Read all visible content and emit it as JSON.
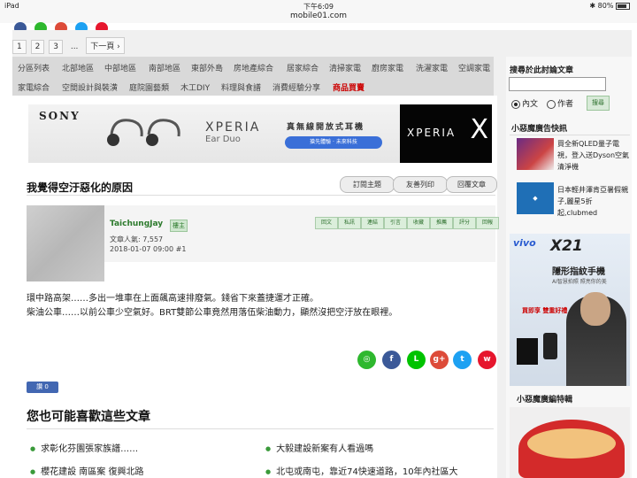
{
  "statusbar": {
    "device": "iPad",
    "time": "下午6:09",
    "url": "mobile01.com",
    "battery": "80%"
  },
  "pager": {
    "pages": [
      "1",
      "2",
      "3"
    ],
    "ellipsis": "...",
    "next": "下一頁 ›"
  },
  "categories": [
    "分區列表",
    "北部地區",
    "中部地區",
    "南部地區",
    "東部外島",
    "房地產綜合",
    "居家綜合",
    "清掃家電",
    "廚房家電",
    "洗濯家電",
    "空調家電",
    "家電綜合",
    "空間設計與裝潢",
    "庭院園藝類",
    "木工DIY",
    "料理與食譜",
    "消費經驗分享",
    "商品買賣"
  ],
  "ad_sony": {
    "brand": "SONY",
    "product": "XPERIA",
    "model": "Ear Duo",
    "tagline": "真無線開放式耳機",
    "cta": "搶先體驗 · 未來科技",
    "logo_text": "XPERIA",
    "logo_mark": "X"
  },
  "thread": {
    "title": "我覺得空汙惡化的原因",
    "buttons": [
      "訂閱主題",
      "友善列印",
      "回覆文章"
    ]
  },
  "post": {
    "username": "TaichungJay",
    "owner_badge": "樓主",
    "popularity": "文章人氣: 7,557",
    "date": "2018-01-07 09:00  #1",
    "actions": [
      "回文",
      "私訊",
      "連結",
      "引言",
      "收藏",
      "推薦",
      "評分",
      "回報"
    ],
    "lines": [
      "環中路高架……多出一堆車在上面飆高速排廢氣。錢省下來蓋捷運才正確。",
      "柴油公車……以前公車少空氣好。BRT雙節公車竟然用落伍柴油動力，顯然沒把空汙放在眼裡。"
    ]
  },
  "share_icons": [
    {
      "name": "line-alt-icon",
      "color": "#2eb82e",
      "glyph": "◎"
    },
    {
      "name": "facebook-icon",
      "color": "#3b5998",
      "glyph": "f"
    },
    {
      "name": "line-icon",
      "color": "#00c300",
      "glyph": "L"
    },
    {
      "name": "google-plus-icon",
      "color": "#dd4b39",
      "glyph": "g+"
    },
    {
      "name": "twitter-icon",
      "color": "#1da1f2",
      "glyph": "t"
    },
    {
      "name": "weibo-icon",
      "color": "#e6162d",
      "glyph": "w"
    }
  ],
  "like": {
    "label": "讚 0"
  },
  "related": {
    "heading": "您也可能喜歡這些文章",
    "items": [
      "求彰化芬園張家族譜……",
      "大毅建設新案有人看過嗎",
      "櫻花建設 南區案 復興北路",
      "北屯或南屯，靠近74快速道路，10年內社區大"
    ]
  },
  "sidebar": {
    "search_label": "搜尋於此討論文章",
    "radio_content": "內文",
    "radio_author": "作者",
    "search_button": "搜尋",
    "ads_label": "小惡魔廣告快訊",
    "ads": [
      "買全新QLED量子電視，登入送Dyson空氣清淨機",
      "日本輕井澤肯亞暑假親子,麗星5折起,clubmed"
    ],
    "vivo": {
      "brand": "vivo",
      "model": "X21",
      "headline": "隱形指紋手機",
      "sub": "AI智慧拍照  照亮你的美",
      "buy": "買即享 雙重好禮"
    },
    "editor_label": "小惡魔廣編特輯"
  }
}
